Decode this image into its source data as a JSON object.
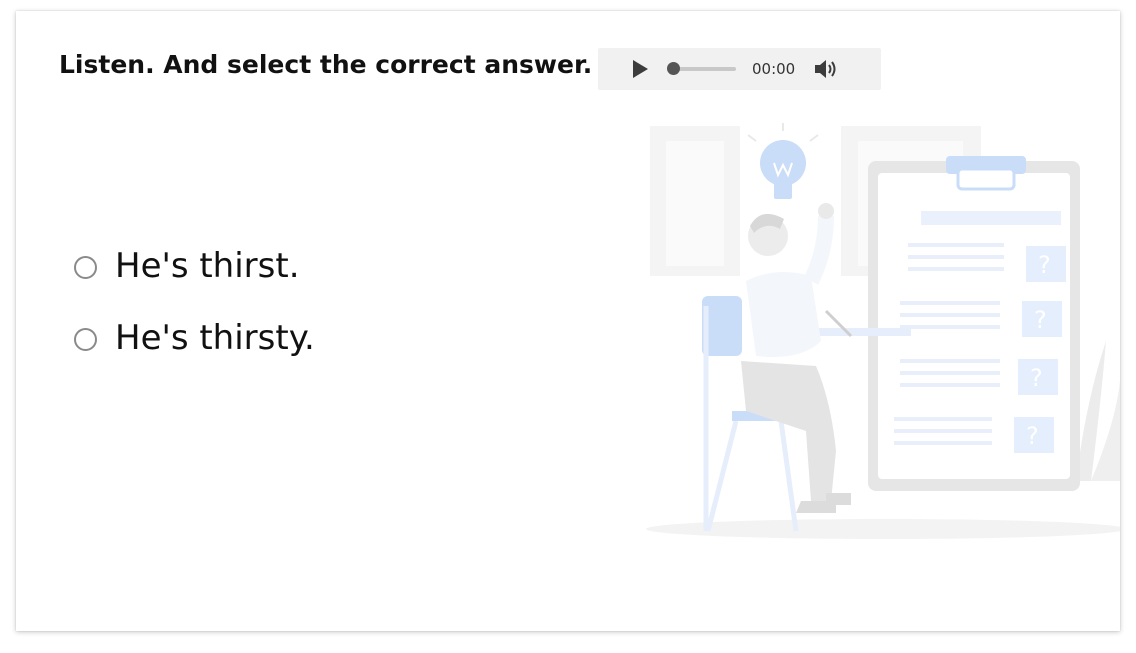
{
  "question": {
    "instruction": "Listen. And select the correct answer."
  },
  "audio": {
    "time": "00:00",
    "progress": 0,
    "icons": {
      "play": "play-icon",
      "volume": "volume-icon"
    }
  },
  "options": [
    {
      "label": "He's thirst.",
      "selected": false
    },
    {
      "label": "He's thirsty.",
      "selected": false
    }
  ],
  "colors": {
    "accent": "#c9dcf8",
    "text": "#111111",
    "player_bg": "#f1f1f1",
    "illustration_gray": "#e9e9e9"
  }
}
